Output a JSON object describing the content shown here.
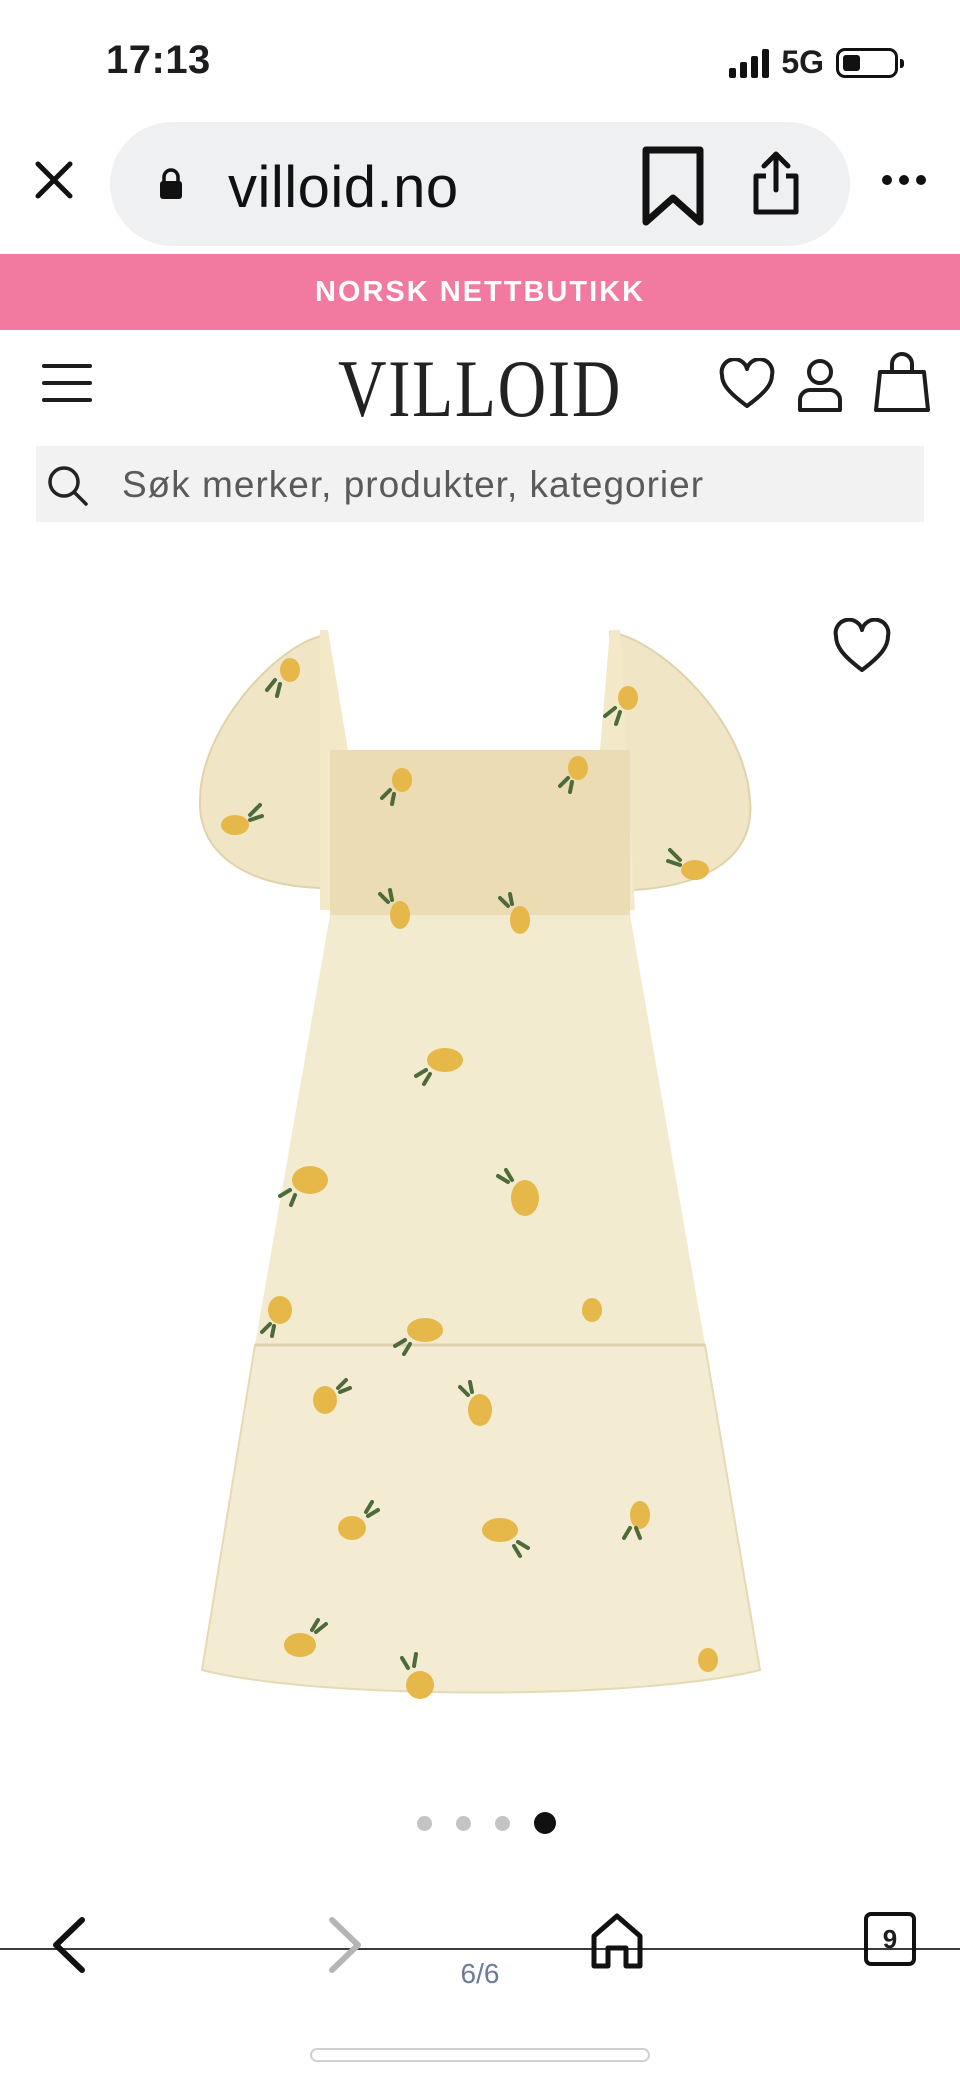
{
  "status_bar": {
    "time": "17:13",
    "network": "5G",
    "battery_level": 0.35
  },
  "browser": {
    "url": "villoid.no",
    "icons": {
      "close": "close-icon",
      "lock": "lock-icon",
      "bookmark": "bookmark-icon",
      "share": "share-icon",
      "more": "more-dots-icon"
    }
  },
  "promo_banner": {
    "text": "NORSK NETTBUTIKK",
    "color": "#f27aa0"
  },
  "site_header": {
    "logo": "VILLOID",
    "icons": [
      "menu-icon",
      "heart-icon",
      "user-icon",
      "shopping-bag-icon"
    ]
  },
  "search": {
    "placeholder": "Søk merker, produkter, kategorier"
  },
  "product": {
    "image_description_icon": "dress-image",
    "wishlist_icon": "heart-outline-icon"
  },
  "carousel": {
    "total": 4,
    "active_index": 3
  },
  "bottom_toolbar": {
    "page_counter": "6/6",
    "tab_count": "9",
    "icons": [
      "back-icon",
      "forward-icon",
      "home-icon",
      "tabs-icon"
    ]
  }
}
